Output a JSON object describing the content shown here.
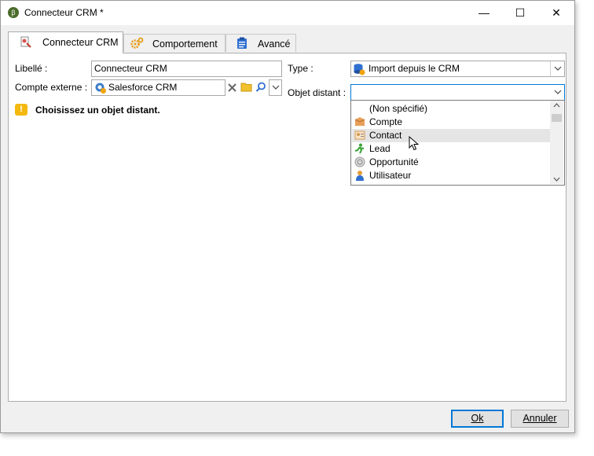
{
  "window": {
    "title": "Connecteur CRM *"
  },
  "titlebar": {
    "minimize": "—",
    "maximize": "☐",
    "close": "✕"
  },
  "tabs": [
    {
      "label": "Connecteur CRM",
      "icon": "connector-icon"
    },
    {
      "label": "Comportement",
      "icon": "gears-icon"
    },
    {
      "label": "Avancé",
      "icon": "clipboard-icon"
    }
  ],
  "form": {
    "libelle_label": "Libellé :",
    "libelle_value": "Connecteur CRM",
    "compte_label": "Compte externe :",
    "compte_value": "Salesforce CRM",
    "type_label": "Type :",
    "type_value": "Import depuis le CRM",
    "objet_label": "Objet distant :",
    "objet_value": ""
  },
  "warning": {
    "text": "Choisissez un objet distant."
  },
  "dropdown": {
    "items": [
      {
        "label": "(Non spécifié)",
        "icon": ""
      },
      {
        "label": "Compte",
        "icon": "account-icon"
      },
      {
        "label": "Contact",
        "icon": "contact-icon",
        "hovered": true
      },
      {
        "label": "Lead",
        "icon": "lead-icon"
      },
      {
        "label": "Opportunité",
        "icon": "opportunity-icon"
      },
      {
        "label": "Utilisateur",
        "icon": "user-icon"
      }
    ]
  },
  "buttons": {
    "ok": "Ok",
    "cancel": "Annuler"
  },
  "colors": {
    "accent": "#0078d7",
    "warning": "#f3b90f"
  }
}
